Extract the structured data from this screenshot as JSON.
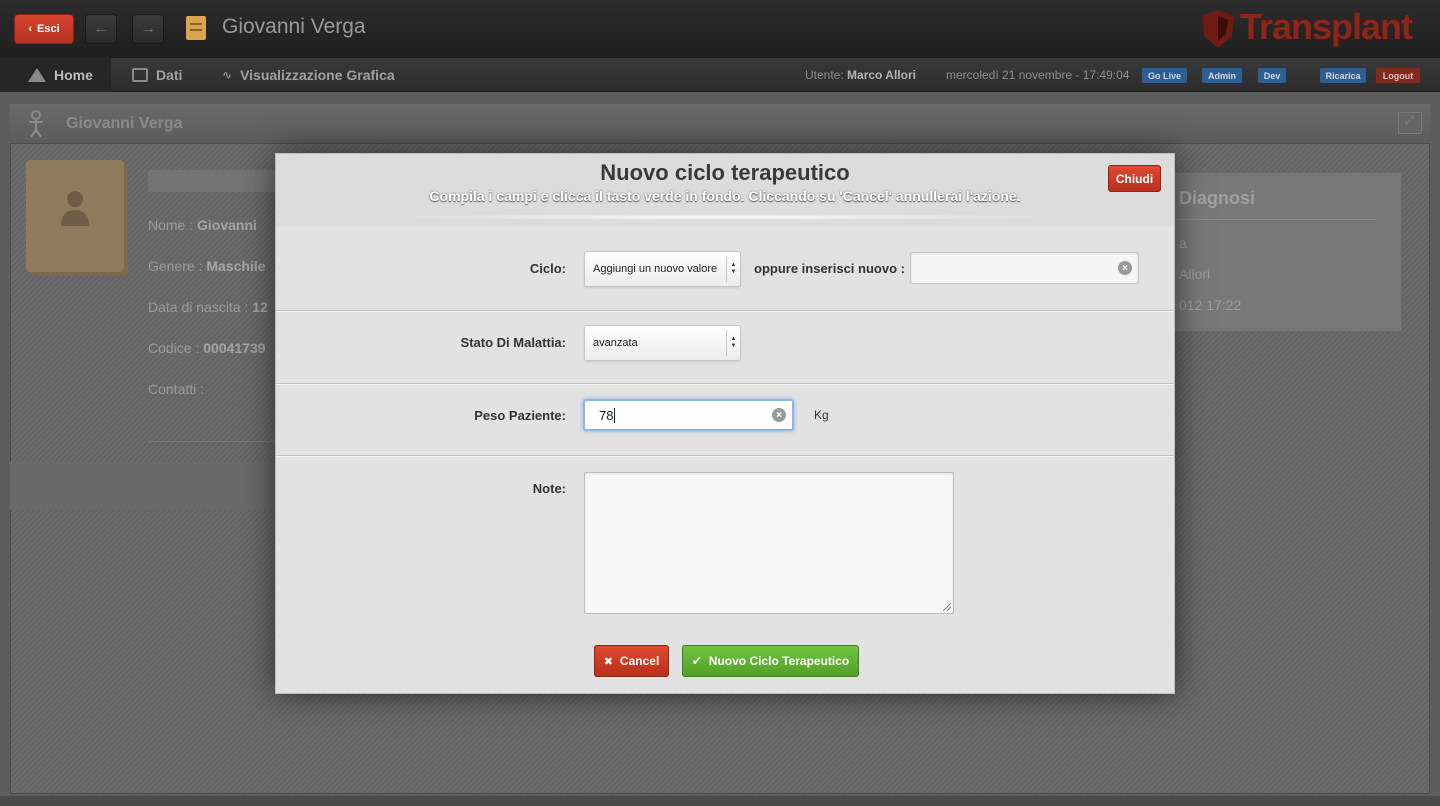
{
  "header": {
    "back_label": "Esci",
    "title": "Giovanni Verga",
    "logo_text": "Transplant",
    "nav": {
      "home": "Home",
      "dati": "Dati",
      "grafica": "Visualizzazione Grafica"
    },
    "user_prefix": "Utente:",
    "user_name": "Marco Allori",
    "datetime": "mercoledì 21 novembre - 17:49:04",
    "pills": {
      "go_live": "Go Live",
      "admin": "Admin",
      "dev": "Dev",
      "ricarica": "Ricarica",
      "logout": "Logout"
    }
  },
  "background": {
    "panel_title": "Giovanni Verga",
    "fields": {
      "nome_label": "Nome :",
      "nome_value": "Giovanni",
      "genere_label": "Genere :",
      "genere_value": "Maschile",
      "nascita_label": "Data di nascita :",
      "nascita_value": "12",
      "codice_label": "Codice :",
      "codice_value": "00041739",
      "contatti_label": "Contatti :"
    },
    "right_card": {
      "title": "Diagnosi",
      "line1": "a",
      "line2": "Allori",
      "line3": "012 17:22"
    }
  },
  "modal": {
    "title": "Nuovo ciclo terapeutico",
    "subtitle": "Compila i campi e clicca il tasto verde in fondo. Cliccando su 'Cancel' annullerai l'azione.",
    "close_label": "Chiudi",
    "ciclo_label": "Ciclo:",
    "ciclo_selected": "Aggiungi un nuovo valore",
    "oppure_label": "oppure inserisci nuovo :",
    "oppure_value": "",
    "stato_label": "Stato Di Malattia:",
    "stato_selected": "avanzata",
    "peso_label": "Peso Paziente:",
    "peso_value": "78",
    "peso_unit": "Kg",
    "note_label": "Note:",
    "note_value": "",
    "cancel_label": "Cancel",
    "submit_label": "Nuovo Ciclo Terapeutico"
  }
}
